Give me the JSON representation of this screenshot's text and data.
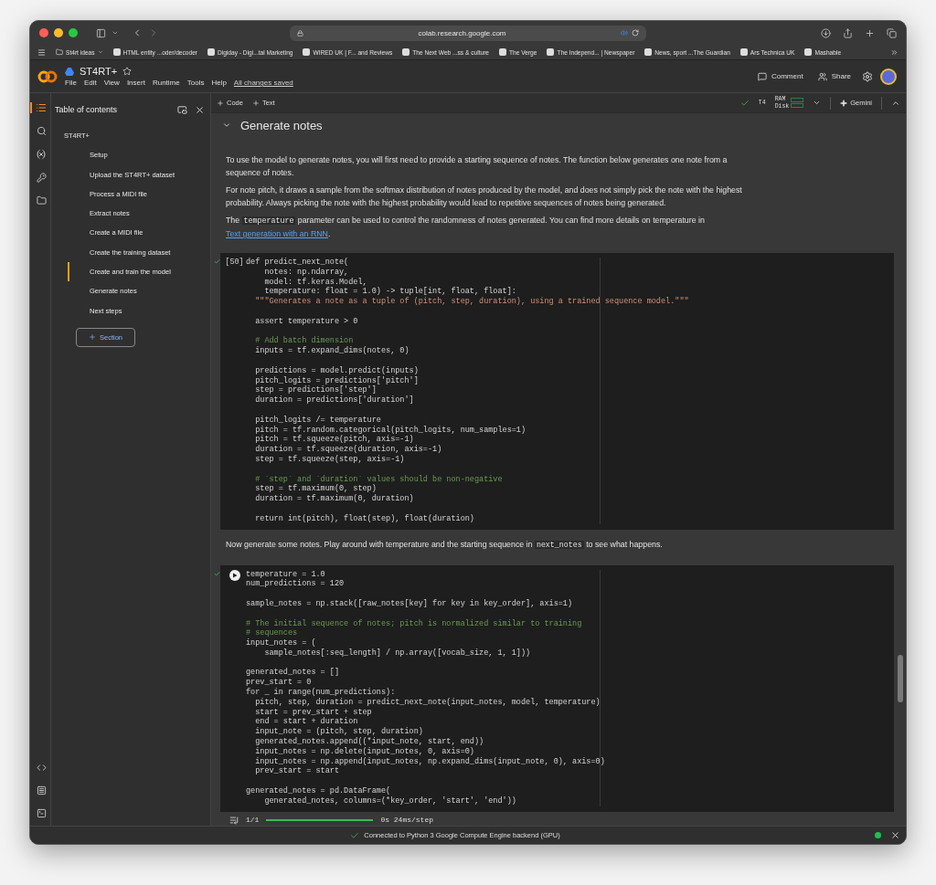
{
  "browser": {
    "url": "colab.research.google.com",
    "bookmarks": [
      {
        "kind": "folder",
        "label": "St4rt ideas"
      },
      {
        "kind": "site",
        "label": "HTML entity ...oder/decoder"
      },
      {
        "kind": "site",
        "label": "Digiday - Digi...tal Marketing"
      },
      {
        "kind": "site",
        "label": "WIRED UK | F... and Reviews"
      },
      {
        "kind": "site",
        "label": "The Next Web ...ss & culture"
      },
      {
        "kind": "site",
        "label": "The Verge"
      },
      {
        "kind": "site",
        "label": "The Independ... | Newspaper"
      },
      {
        "kind": "site",
        "label": "News, sport ...The Guardian"
      },
      {
        "kind": "site",
        "label": "Ars Technica UK"
      },
      {
        "kind": "site",
        "label": "Mashable"
      }
    ]
  },
  "header": {
    "title": "ST4RT+",
    "menu": [
      "File",
      "Edit",
      "View",
      "Insert",
      "Runtime",
      "Tools",
      "Help"
    ],
    "save_status": "All changes saved",
    "actions": [
      "Comment",
      "Share"
    ]
  },
  "toolbar": {
    "insert": [
      "Code",
      "Text"
    ],
    "accelerator": "T4",
    "ram_label": "RAM",
    "disk_label": "Disk",
    "gemini": "Gemini"
  },
  "sidebar": {
    "title": "Table of contents",
    "items": [
      {
        "label": "ST4RT+",
        "selected": false,
        "children": [
          {
            "label": "Setup",
            "selected": false
          },
          {
            "label": "Upload the ST4RT+ dataset",
            "selected": false
          },
          {
            "label": "Process a MIDI file",
            "selected": false
          },
          {
            "label": "Extract notes",
            "selected": false
          },
          {
            "label": "Create a MIDI file",
            "selected": false
          },
          {
            "label": "Create the training dataset",
            "selected": false
          },
          {
            "label": "Create and train the model",
            "selected": true
          },
          {
            "label": "Generate notes",
            "selected": false
          },
          {
            "label": "Next steps",
            "selected": false
          }
        ]
      }
    ],
    "section_button": "Section"
  },
  "section": {
    "title": "Generate notes",
    "expanded": true
  },
  "paragraphs": [
    [
      {
        "kind": "text",
        "text": "To use the model to generate notes, you will first need to provide a starting sequence of notes. The function below generates one note from a sequence of notes."
      }
    ],
    [
      {
        "kind": "text",
        "text": "For note pitch, it draws a sample from the softmax distribution of notes produced by the model, and does not simply pick the note with the highest probability. Always picking the note with the highest probability would lead to repetitive sequences of notes being generated."
      }
    ],
    [
      {
        "kind": "text",
        "text": "The "
      },
      {
        "kind": "code",
        "text": "temperature"
      },
      {
        "kind": "text",
        "text": " parameter can be used to control the randomness of notes generated. You can find more details on temperature in "
      },
      {
        "kind": "link",
        "text": "Text generation with an RNN"
      },
      {
        "kind": "text",
        "text": "."
      }
    ]
  ],
  "cells": [
    {
      "kind": "count",
      "count": "[50]",
      "lines": [
        {
          "kind": "code",
          "text": "def predict_next_note("
        },
        {
          "kind": "code",
          "text": "    notes: np.ndarray,"
        },
        {
          "kind": "code",
          "text": "    model: tf.keras.Model,"
        },
        {
          "kind": "code",
          "text": "    temperature: float = 1.0) -> tuple[int, float, float]:"
        },
        {
          "kind": "string",
          "text": "  \"\"\"Generates a note as a tuple of (pitch, step, duration), using a trained sequence model.\"\"\""
        },
        {
          "kind": "blank"
        },
        {
          "kind": "code",
          "text": "  assert temperature > 0"
        },
        {
          "kind": "blank"
        },
        {
          "kind": "comment",
          "text": "  # Add batch dimension"
        },
        {
          "kind": "code",
          "text": "  inputs = tf.expand_dims(notes, 0)"
        },
        {
          "kind": "blank"
        },
        {
          "kind": "code",
          "text": "  predictions = model.predict(inputs)"
        },
        {
          "kind": "code",
          "text": "  pitch_logits = predictions['pitch']"
        },
        {
          "kind": "code",
          "text": "  step = predictions['step']"
        },
        {
          "kind": "code",
          "text": "  duration = predictions['duration']"
        },
        {
          "kind": "blank"
        },
        {
          "kind": "code",
          "text": "  pitch_logits /= temperature"
        },
        {
          "kind": "code",
          "text": "  pitch = tf.random.categorical(pitch_logits, num_samples=1)"
        },
        {
          "kind": "code",
          "text": "  pitch = tf.squeeze(pitch, axis=-1)"
        },
        {
          "kind": "code",
          "text": "  duration = tf.squeeze(duration, axis=-1)"
        },
        {
          "kind": "code",
          "text": "  step = tf.squeeze(step, axis=-1)"
        },
        {
          "kind": "blank"
        },
        {
          "kind": "comment",
          "text": "  # `step` and `duration` values should be non-negative"
        },
        {
          "kind": "code",
          "text": "  step = tf.maximum(0, step)"
        },
        {
          "kind": "code",
          "text": "  duration = tf.maximum(0, duration)"
        },
        {
          "kind": "blank"
        },
        {
          "kind": "code",
          "text": "  return int(pitch), float(step), float(duration)"
        }
      ]
    },
    {
      "kind": "run",
      "lines": [
        {
          "kind": "code",
          "text": "temperature = 1.0"
        },
        {
          "kind": "code",
          "text": "num_predictions = 120"
        },
        {
          "kind": "blank"
        },
        {
          "kind": "code",
          "text": "sample_notes = np.stack([raw_notes[key] for key in key_order], axis=1)"
        },
        {
          "kind": "blank"
        },
        {
          "kind": "comment",
          "text": "# The initial sequence of notes; pitch is normalized similar to training"
        },
        {
          "kind": "comment",
          "text": "# sequences"
        },
        {
          "kind": "code",
          "text": "input_notes = ("
        },
        {
          "kind": "code",
          "text": "    sample_notes[:seq_length] / np.array([vocab_size, 1, 1]))"
        },
        {
          "kind": "blank"
        },
        {
          "kind": "code",
          "text": "generated_notes = []"
        },
        {
          "kind": "code",
          "text": "prev_start = 0"
        },
        {
          "kind": "code",
          "text": "for _ in range(num_predictions):"
        },
        {
          "kind": "code",
          "text": "  pitch, step, duration = predict_next_note(input_notes, model, temperature)"
        },
        {
          "kind": "code",
          "text": "  start = prev_start + step"
        },
        {
          "kind": "code",
          "text": "  end = start + duration"
        },
        {
          "kind": "code",
          "text": "  input_note = (pitch, step, duration)"
        },
        {
          "kind": "code",
          "text": "  generated_notes.append((*input_note, start, end))"
        },
        {
          "kind": "code",
          "text": "  input_notes = np.delete(input_notes, 0, axis=0)"
        },
        {
          "kind": "code",
          "text": "  input_notes = np.append(input_notes, np.expand_dims(input_note, 0), axis=0)"
        },
        {
          "kind": "code",
          "text": "  prev_start = start"
        },
        {
          "kind": "blank"
        },
        {
          "kind": "code",
          "text": "generated_notes = pd.DataFrame("
        },
        {
          "kind": "code",
          "text": "    generated_notes, columns=(*key_order, 'start', 'end'))"
        }
      ],
      "output": {
        "count": "1/1",
        "level": 1,
        "timing": "0s 24ms/step"
      }
    }
  ],
  "between_text": [
    {
      "kind": "text",
      "text": "Now generate some notes. Play around with temperature and the starting sequence in "
    },
    {
      "kind": "code",
      "text": "next_notes"
    },
    {
      "kind": "text",
      "text": " to see what happens."
    }
  ],
  "status_bar": {
    "message": "Connected to Python 3 Google Compute Engine backend (GPU)"
  }
}
